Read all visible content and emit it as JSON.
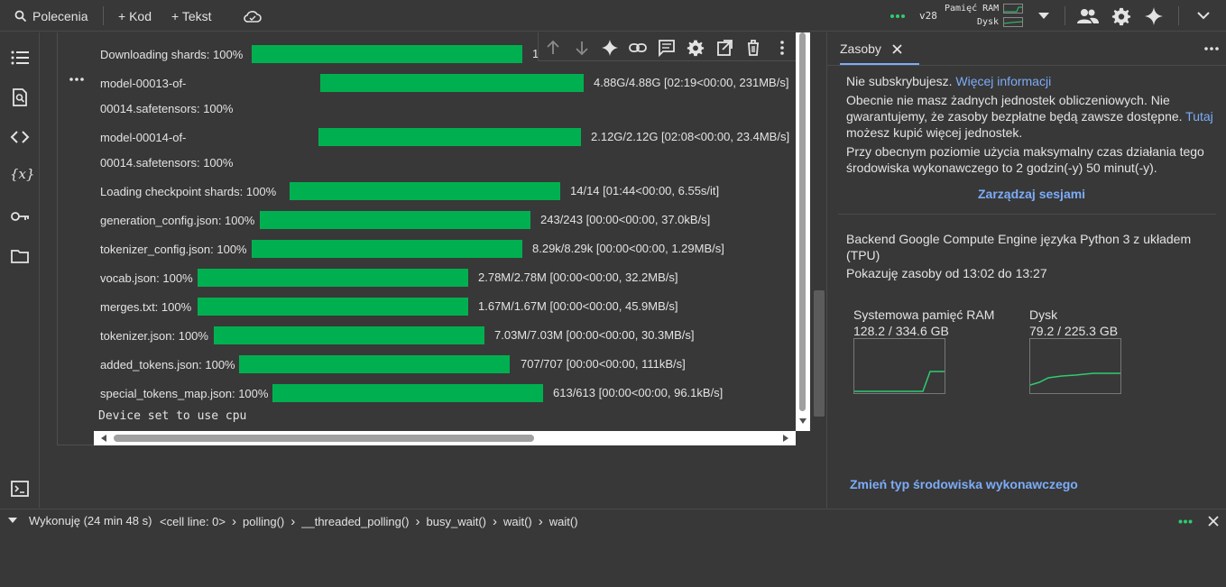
{
  "topbar": {
    "commands_label": "Polecenia",
    "add_code_label": "+ Kod",
    "add_text_label": "+ Tekst",
    "runtime_version": "v28",
    "ram_label": "Pamięć RAM",
    "disk_label": "Dysk"
  },
  "output": {
    "rows": [
      {
        "label": "Downloading shards: 100%",
        "stat": "1"
      },
      {
        "label": "model-00013-of-",
        "stat": "4.88G/4.88G  [02:19<00:00,  231MB/s]"
      },
      {
        "label": "00014.safetensors: 100%",
        "stat": ""
      },
      {
        "label": "model-00014-of-",
        "stat": "2.12G/2.12G  [02:08<00:00,  23.4MB/s]"
      },
      {
        "label": "00014.safetensors: 100%",
        "stat": ""
      },
      {
        "label": "Loading checkpoint shards: 100%",
        "stat": "14/14  [01:44<00:00,    6.55s/it]"
      },
      {
        "label": "generation_config.json: 100%",
        "stat": "243/243  [00:00<00:00,  37.0kB/s]"
      },
      {
        "label": "tokenizer_config.json: 100%",
        "stat": "8.29k/8.29k  [00:00<00:00,  1.29MB/s]"
      },
      {
        "label": "vocab.json: 100%",
        "stat": "2.78M/2.78M  [00:00<00:00,  32.2MB/s]"
      },
      {
        "label": "merges.txt: 100%",
        "stat": "1.67M/1.67M  [00:00<00:00,  45.9MB/s]"
      },
      {
        "label": "tokenizer.json: 100%",
        "stat": "7.03M/7.03M  [00:00<00:00,  30.3MB/s]"
      },
      {
        "label": "added_tokens.json: 100%",
        "stat": "707/707  [00:00<00:00,  111kB/s]"
      },
      {
        "label": "special_tokens_map.json: 100%",
        "stat": "613/613  [00:00<00:00,  96.1kB/s]"
      }
    ],
    "final_text": "Device set to use cpu"
  },
  "panel": {
    "tab_label": "Zasoby",
    "line1_text": "Nie subskrybujesz.",
    "line1_link": "Więcej informacji",
    "para1_a": "Obecnie nie masz żadnych jednostek obliczeniowych. Nie",
    "para1_b": "gwarantujemy, że zasoby bezpłatne będą zawsze dostępne.",
    "para1_link": "Tutaj",
    "para1_c": "możesz kupić więcej jednostek.",
    "para2_a": "Przy obecnym poziomie użycia maksymalny czas działania tego",
    "para2_b": "środowiska wykonawczego to 2 godzin(-y) 50 minut(-y).",
    "manage_sessions": "Zarządzaj sesjami",
    "backend_a": "Backend Google Compute Engine języka Python 3 z układem",
    "backend_b": "(TPU)",
    "showing": "Pokazuję zasoby od 13:02 do 13:27",
    "ram_title": "Systemowa pamięć RAM",
    "ram_value": "128.2 / 334.6 GB",
    "disk_title": "Dysk",
    "disk_value": "79.2 / 225.3 GB",
    "change_runtime": "Zmień typ środowiska wykonawczego"
  },
  "status": {
    "executing": "Wykonuję (24 min 48 s)",
    "crumbs": [
      "<cell line: 0>",
      "polling()",
      "__threaded_polling()",
      "busy_wait()",
      "wait()",
      "wait()"
    ]
  },
  "colors": {
    "progress": "#00b050",
    "link": "#7cacf8",
    "accent_green": "#2ecc71"
  }
}
